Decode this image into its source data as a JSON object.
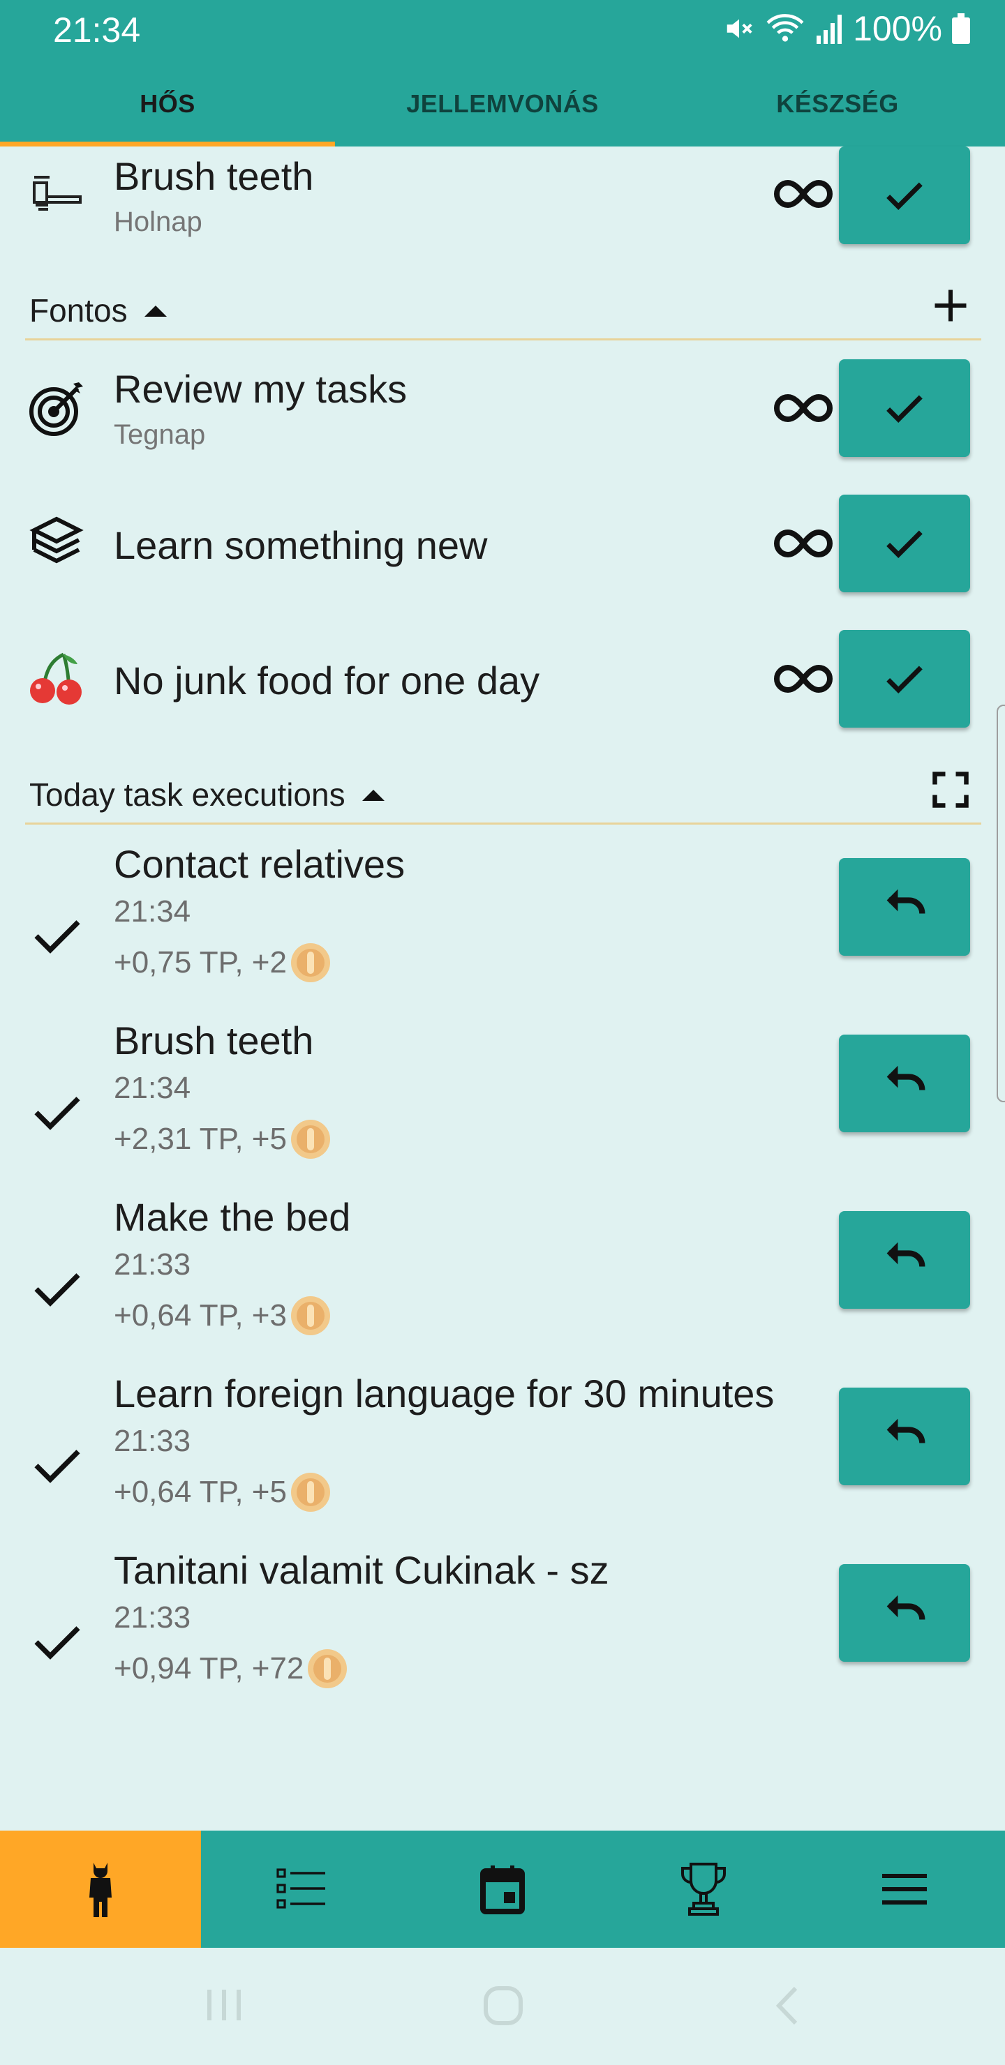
{
  "status_bar": {
    "time": "21:34",
    "battery": "100%"
  },
  "tabs": [
    {
      "label": "HŐS",
      "active": true
    },
    {
      "label": "JELLEMVONÁS",
      "active": false
    },
    {
      "label": "KÉSZSÉG",
      "active": false
    }
  ],
  "top_task": {
    "title": "Brush teeth",
    "subtitle": "Holnap",
    "icon": "toothbrush-icon"
  },
  "important_section": {
    "label": "Fontos"
  },
  "important_tasks": [
    {
      "title": "Review my tasks",
      "subtitle": "Tegnap",
      "icon": "target-icon"
    },
    {
      "title": "Learn something new",
      "subtitle": "",
      "icon": "books-icon"
    },
    {
      "title": "No junk food for one day",
      "subtitle": "",
      "icon": "cherry-icon"
    }
  ],
  "executions_section": {
    "label": "Today task executions"
  },
  "executions": [
    {
      "title": "Contact relatives",
      "time": "21:34",
      "reward": "+0,75 TP, +2"
    },
    {
      "title": "Brush teeth",
      "time": "21:34",
      "reward": "+2,31 TP, +5"
    },
    {
      "title": "Make the bed",
      "time": "21:33",
      "reward": "+0,64 TP, +3"
    },
    {
      "title": "Learn foreign language for 30 minutes",
      "time": "21:33",
      "reward": "+0,64 TP, +5"
    },
    {
      "title": "Tanitani valamit Cukinak - sz",
      "time": "21:33",
      "reward": "+0,94 TP, +72"
    }
  ],
  "bottom_nav": [
    {
      "icon": "hero-icon",
      "active": true
    },
    {
      "icon": "list-icon",
      "active": false
    },
    {
      "icon": "calendar-icon",
      "active": false
    },
    {
      "icon": "trophy-icon",
      "active": false
    },
    {
      "icon": "menu-icon",
      "active": false
    }
  ],
  "colors": {
    "primary": "#26a69a",
    "accent": "#ffa726",
    "background": "#e0f2f1",
    "divider": "#e8d39a"
  }
}
